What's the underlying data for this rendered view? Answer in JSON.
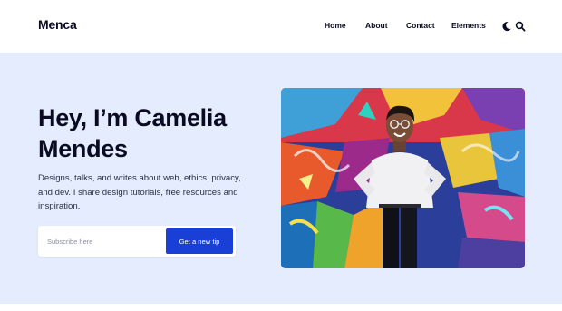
{
  "header": {
    "logo": "Menca",
    "nav": [
      {
        "label": "Home"
      },
      {
        "label": "About"
      },
      {
        "label": "Contact"
      },
      {
        "label": "Elements"
      }
    ],
    "icons": [
      "moon-icon",
      "search-icon"
    ]
  },
  "hero": {
    "headline_line1": "Hey, I’m Camelia",
    "headline_line2": "Mendes",
    "description": "Designs, talks, and writes about web, ethics, privacy, and dev. I share design tutorials, free resources and inspiration.",
    "subscribe": {
      "placeholder": "Subscribe here",
      "button_label": "Get a new tip"
    }
  },
  "colors": {
    "hero_bg": "#e4ecfd",
    "accent": "#1a3fd6",
    "text": "#0a0a23"
  }
}
